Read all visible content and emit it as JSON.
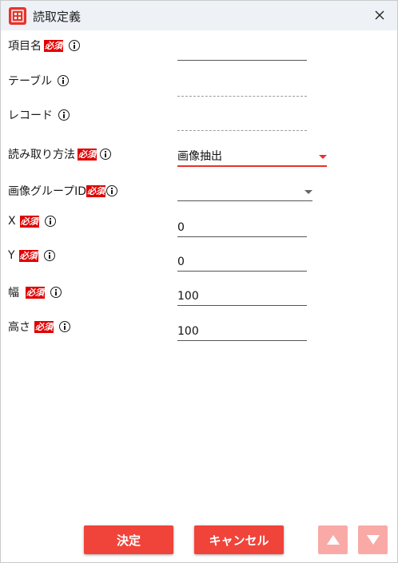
{
  "window": {
    "title": "読取定義"
  },
  "fields": {
    "item_name": {
      "label": "項目名",
      "required": "必須",
      "value": ""
    },
    "table": {
      "label": "テーブル",
      "value": ""
    },
    "record": {
      "label": "レコード",
      "value": ""
    },
    "read_method": {
      "label": "読み取り方法",
      "required": "必須",
      "value": "画像抽出"
    },
    "image_group_id": {
      "label": "画像グループID",
      "required": "必須",
      "value": ""
    },
    "x": {
      "label": "X",
      "required": "必須",
      "value": "0"
    },
    "y": {
      "label": "Y",
      "required": "必須",
      "value": "0"
    },
    "width": {
      "label": "幅",
      "required": "必須",
      "value": "100"
    },
    "height": {
      "label": "高さ",
      "required": "必須",
      "value": "100"
    }
  },
  "buttons": {
    "ok": "決定",
    "cancel": "キャンセル"
  },
  "colors": {
    "accent": "#f0443a",
    "required_badge": "#e00000",
    "disabled_arrow": "#f9aaa6",
    "titlebar": "#eef1f6"
  }
}
